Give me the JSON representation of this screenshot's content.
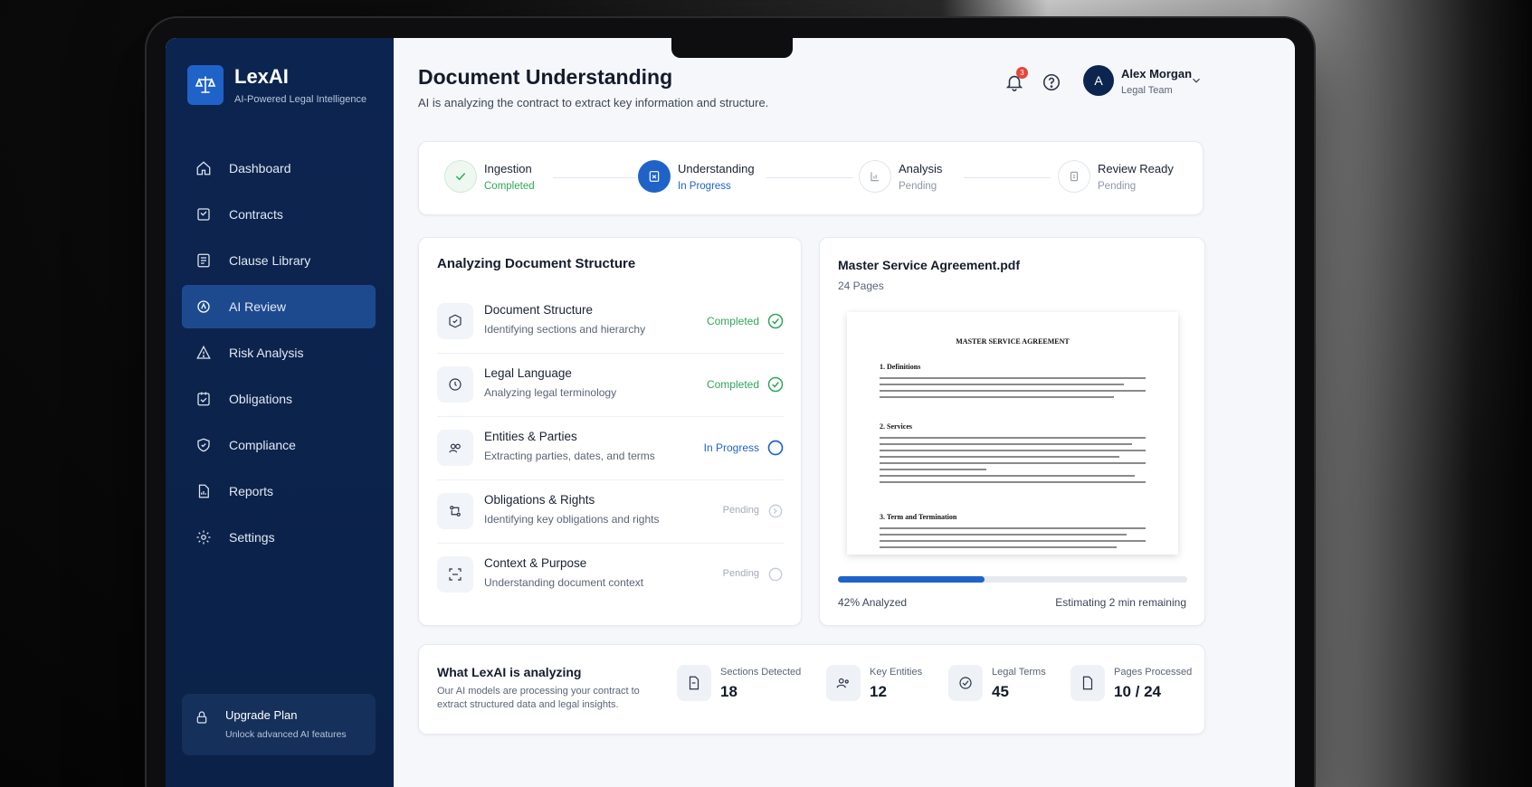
{
  "brand": {
    "name": "LexAI",
    "tagline": "AI-Powered Legal Intelligence"
  },
  "sidebar": {
    "items": [
      {
        "label": "Dashboard",
        "icon": "home-icon",
        "active": false
      },
      {
        "label": "Contracts",
        "icon": "contracts-icon",
        "active": false
      },
      {
        "label": "Clause Library",
        "icon": "library-icon",
        "active": false
      },
      {
        "label": "AI Review",
        "icon": "ai-review-icon",
        "active": true
      },
      {
        "label": "Risk Analysis",
        "icon": "risk-icon",
        "active": false
      },
      {
        "label": "Obligations",
        "icon": "obligations-icon",
        "active": false
      },
      {
        "label": "Compliance",
        "icon": "shield-icon",
        "active": false
      },
      {
        "label": "Reports",
        "icon": "reports-icon",
        "active": false
      },
      {
        "label": "Settings",
        "icon": "gear-icon",
        "active": false
      }
    ],
    "upgrade": {
      "title": "Upgrade Plan",
      "subtitle": "Unlock advanced AI features"
    }
  },
  "header": {
    "title": "Document Understanding",
    "subtitle": "AI is analyzing the contract to extract key information and structure.",
    "notification_count": "3",
    "user": {
      "initial": "A",
      "name": "Alex Morgan",
      "role": "Legal Team"
    }
  },
  "steps": [
    {
      "name": "Ingestion",
      "status": "Completed"
    },
    {
      "name": "Understanding",
      "status": "In Progress"
    },
    {
      "name": "Analysis",
      "status": "Pending"
    },
    {
      "name": "Review Ready",
      "status": "Pending"
    }
  ],
  "structure": {
    "title": "Analyzing Document Structure",
    "tasks": [
      {
        "name": "Document Structure",
        "desc": "Identifying sections and hierarchy",
        "status": "Completed"
      },
      {
        "name": "Legal Language",
        "desc": "Analyzing legal terminology",
        "status": "Completed"
      },
      {
        "name": "Entities & Parties",
        "desc": "Extracting parties, dates, and terms",
        "status": "In Progress"
      },
      {
        "name": "Obligations & Rights",
        "desc": "Identifying key obligations and rights",
        "status": "Pending"
      },
      {
        "name": "Context & Purpose",
        "desc": "Understanding document context",
        "status": "Pending"
      }
    ]
  },
  "preview": {
    "filename": "Master Service Agreement.pdf",
    "pages": "24 Pages",
    "doc_heading": "MASTER SERVICE AGREEMENT",
    "sections": [
      "1. Definitions",
      "2. Services",
      "3. Term and Termination"
    ],
    "progress_percent": 42,
    "progress_label": "42% Analyzed",
    "eta": "Estimating 2 min remaining"
  },
  "summary": {
    "title": "What LexAI is analyzing",
    "desc": "Our AI models are processing your contract to extract structured data and legal insights.",
    "stats": [
      {
        "label": "Sections Detected",
        "value": "18",
        "icon": "sections-icon"
      },
      {
        "label": "Key Entities",
        "value": "12",
        "icon": "entities-icon"
      },
      {
        "label": "Legal Terms",
        "value": "45",
        "icon": "legal-terms-icon"
      },
      {
        "label": "Pages Processed",
        "value": "10 / 24",
        "icon": "pages-icon"
      }
    ]
  },
  "colors": {
    "accent": "#1f63c9",
    "sidebar": "#0c2550",
    "success": "#2fa65a",
    "pending": "#a3aab6"
  }
}
